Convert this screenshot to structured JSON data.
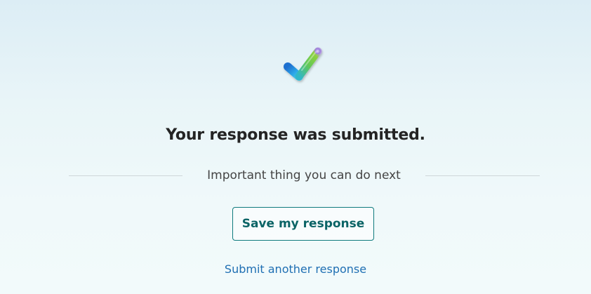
{
  "confirmation": {
    "icon": "checkmark-icon",
    "title": "Your response was submitted."
  },
  "next_steps": {
    "heading": "Important thing you can do next",
    "save_button_label": "Save my response",
    "submit_another_label": "Submit another response"
  },
  "colors": {
    "accent": "#0f7b7d",
    "link": "#1f6fb3",
    "title": "#242424"
  }
}
